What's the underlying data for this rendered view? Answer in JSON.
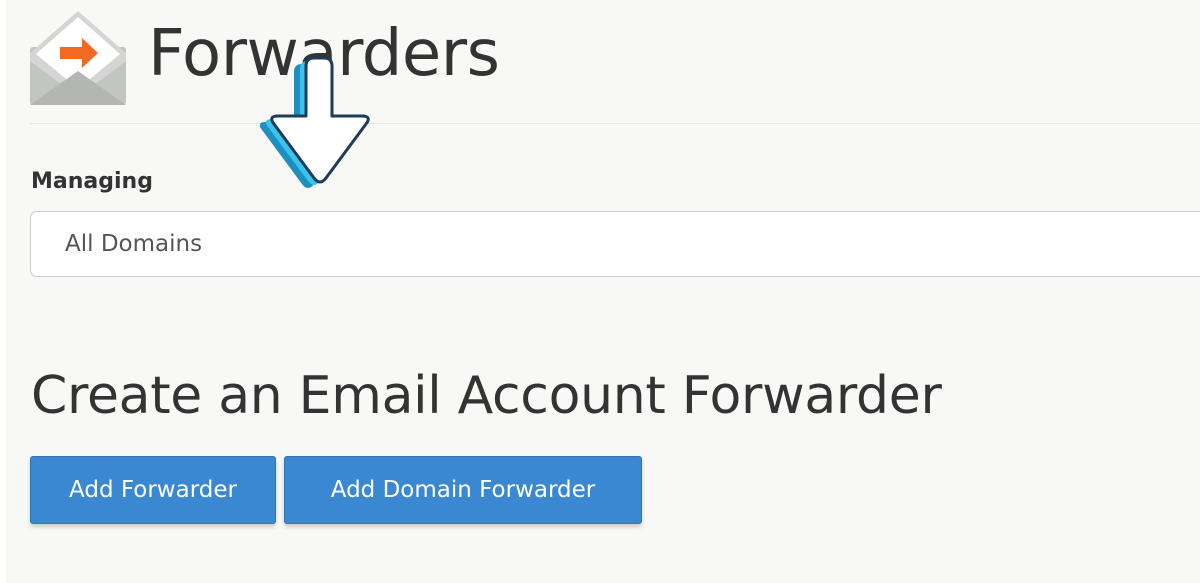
{
  "header": {
    "title": "Forwarders",
    "icon": "email-forward-icon"
  },
  "managing": {
    "label": "Managing",
    "selected_value": "All Domains"
  },
  "create_section": {
    "title": "Create an Email Account Forwarder",
    "buttons": [
      {
        "label": "Add Forwarder"
      },
      {
        "label": "Add Domain Forwarder"
      }
    ]
  },
  "overlay": {
    "icon": "down-arrow-pointer-icon"
  },
  "colors": {
    "primary_button": "#3a88d2",
    "icon_orange": "#f26a21",
    "icon_gray": "#b9bcb8",
    "arrow_cyan": "#28a9d6"
  }
}
